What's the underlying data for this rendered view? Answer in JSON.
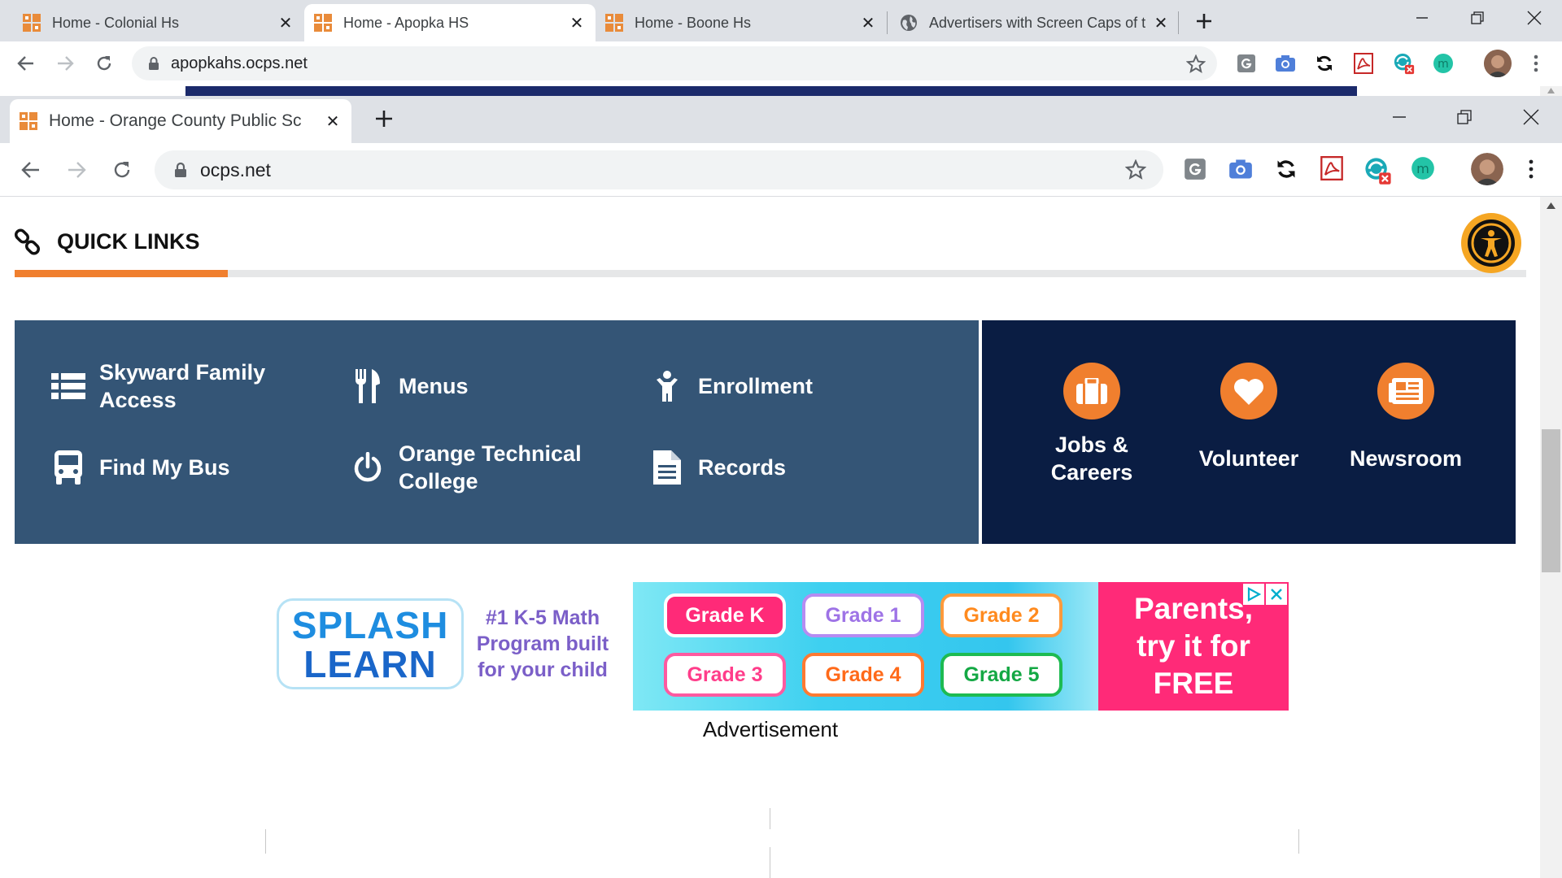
{
  "back_window": {
    "tabs": [
      {
        "label": "Home - Colonial Hs"
      },
      {
        "label": "Home - Apopka HS"
      },
      {
        "label": "Home - Boone Hs"
      },
      {
        "label": "Advertisers with Screen Caps of t"
      }
    ],
    "url": "apopkahs.ocps.net"
  },
  "front_window": {
    "tab": {
      "label": "Home - Orange County Public Sc"
    },
    "url": "ocps.net"
  },
  "quick_links": {
    "heading": "QUICK LINKS",
    "items": [
      {
        "label_line1": "Skyward Family",
        "label_line2": "Access",
        "icon": "list-icon"
      },
      {
        "label_line1": "Menus",
        "label_line2": "",
        "icon": "utensils-icon"
      },
      {
        "label_line1": "Enrollment",
        "label_line2": "",
        "icon": "child-icon"
      },
      {
        "label_line1": "Find My Bus",
        "label_line2": "",
        "icon": "bus-icon"
      },
      {
        "label_line1": "Orange Technical",
        "label_line2": "College",
        "icon": "power-icon"
      },
      {
        "label_line1": "Records",
        "label_line2": "",
        "icon": "document-icon"
      }
    ],
    "featured": [
      {
        "label_line1": "Jobs &",
        "label_line2": "Careers",
        "icon": "briefcase-icon"
      },
      {
        "label_line1": "Volunteer",
        "label_line2": "",
        "icon": "heart-icon"
      },
      {
        "label_line1": "Newsroom",
        "label_line2": "",
        "icon": "newspaper-icon"
      }
    ]
  },
  "ad": {
    "brand_line1": "SPLASH",
    "brand_line2": "LEARN",
    "tagline_line1": "#1 K-5 Math",
    "tagline_line2": "Program built",
    "tagline_line3": "for your child",
    "grades": [
      "Grade K",
      "Grade 1",
      "Grade 2",
      "Grade 3",
      "Grade 4",
      "Grade 5"
    ],
    "cta_line1": "Parents,",
    "cta_line2": "try it for",
    "cta_line3": "FREE",
    "caption": "Advertisement"
  },
  "colors": {
    "panel_blue": "#345576",
    "panel_navy": "#0a1d43",
    "accent_orange": "#f07f2e",
    "ad_pink": "#ff2a78"
  }
}
